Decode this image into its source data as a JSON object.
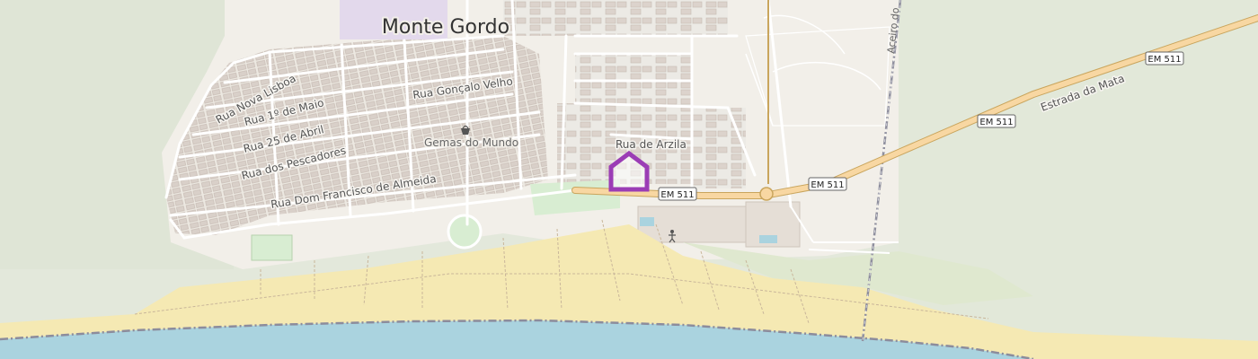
{
  "map": {
    "place_name": "Monte Gordo",
    "streets": {
      "nova_lisboa": "Rua Nova Lisboa",
      "goncalo_velho": "Rua Gonçalo Velho",
      "primeiro_maio": "Rua 1º de Maio",
      "vinte_cinco_abril": "Rua 25 de Abril",
      "pescadores": "Rua dos Pescadores",
      "dom_francisco": "Rua Dom Francisco de Almeida",
      "arzila": "Rua de Arzila",
      "estrada_mata": "Estrada da Mata",
      "aceiro": "Aceiro do"
    },
    "pois": {
      "gemas": "Gemas do Mundo"
    },
    "road_refs": {
      "em511_a": "EM 511",
      "em511_b": "EM 511",
      "em511_c": "EM 511",
      "em511_d": "EM 511"
    },
    "marker": {
      "icon": "house-marker-icon",
      "color": "#9b3db5"
    },
    "colors": {
      "land": "#f2efe9",
      "forest": "#dfe6d6",
      "beach": "#f5e9b3",
      "water": "#aad3df",
      "school": "#e3d9ec",
      "primary_road": "#f8d7a2",
      "park": "#d8edd2"
    }
  }
}
